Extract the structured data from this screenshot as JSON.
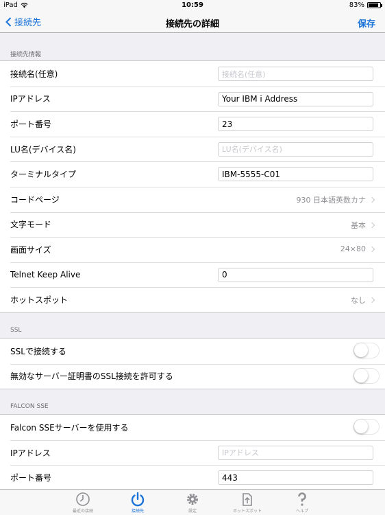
{
  "status": {
    "device": "iPad",
    "time": "10:59",
    "battery": "83%"
  },
  "nav": {
    "back_label": "接続先",
    "title": "接続先の詳細",
    "save_label": "保存"
  },
  "colors": {
    "accent": "#1a73d9",
    "separator": "#c8c7cc",
    "background": "#efeff4"
  },
  "sections": {
    "info": {
      "header": "接続先情報",
      "rows": {
        "name": {
          "label": "接続名(任意)",
          "value": "",
          "placeholder": "接続名(任意)"
        },
        "ip": {
          "label": "IPアドレス",
          "value": "Your IBM i Address",
          "placeholder": ""
        },
        "port": {
          "label": "ポート番号",
          "value": "23",
          "placeholder": ""
        },
        "lu": {
          "label": "LU名(デバイス名)",
          "value": "",
          "placeholder": "LU名(デバイス名)"
        },
        "terminal": {
          "label": "ターミナルタイプ",
          "value": "IBM-5555-C01",
          "placeholder": ""
        },
        "codepage": {
          "label": "コードページ",
          "value": "930 日本語英数カナ"
        },
        "charmode": {
          "label": "文字モード",
          "value": "基本"
        },
        "screensize": {
          "label": "画面サイズ",
          "value": "24×80"
        },
        "keepalive": {
          "label": "Telnet Keep Alive",
          "value": "0",
          "placeholder": ""
        },
        "hotspot": {
          "label": "ホットスポット",
          "value": "なし"
        }
      }
    },
    "ssl": {
      "header": "SSL",
      "rows": {
        "connect": {
          "label": "SSLで接続する",
          "on": false
        },
        "invalid_cert": {
          "label": "無効なサーバー証明書のSSL接続を許可する",
          "on": false
        }
      }
    },
    "falcon": {
      "header": "FALCON SSE",
      "rows": {
        "use": {
          "label": "Falcon SSEサーバーを使用する",
          "on": false
        },
        "ip": {
          "label": "IPアドレス",
          "value": "",
          "placeholder": "IPアドレス"
        },
        "port": {
          "label": "ポート番号",
          "value": "443",
          "placeholder": ""
        }
      }
    }
  },
  "tabs": {
    "recent": {
      "label": "最近の接続",
      "icon": "clock-icon"
    },
    "connections": {
      "label": "接続先",
      "icon": "power-icon",
      "active": true
    },
    "settings": {
      "label": "設定",
      "icon": "gear-icon"
    },
    "hotspot": {
      "label": "ホットスポット",
      "icon": "export-icon"
    },
    "help": {
      "label": "ヘルプ",
      "icon": "question-icon"
    }
  }
}
